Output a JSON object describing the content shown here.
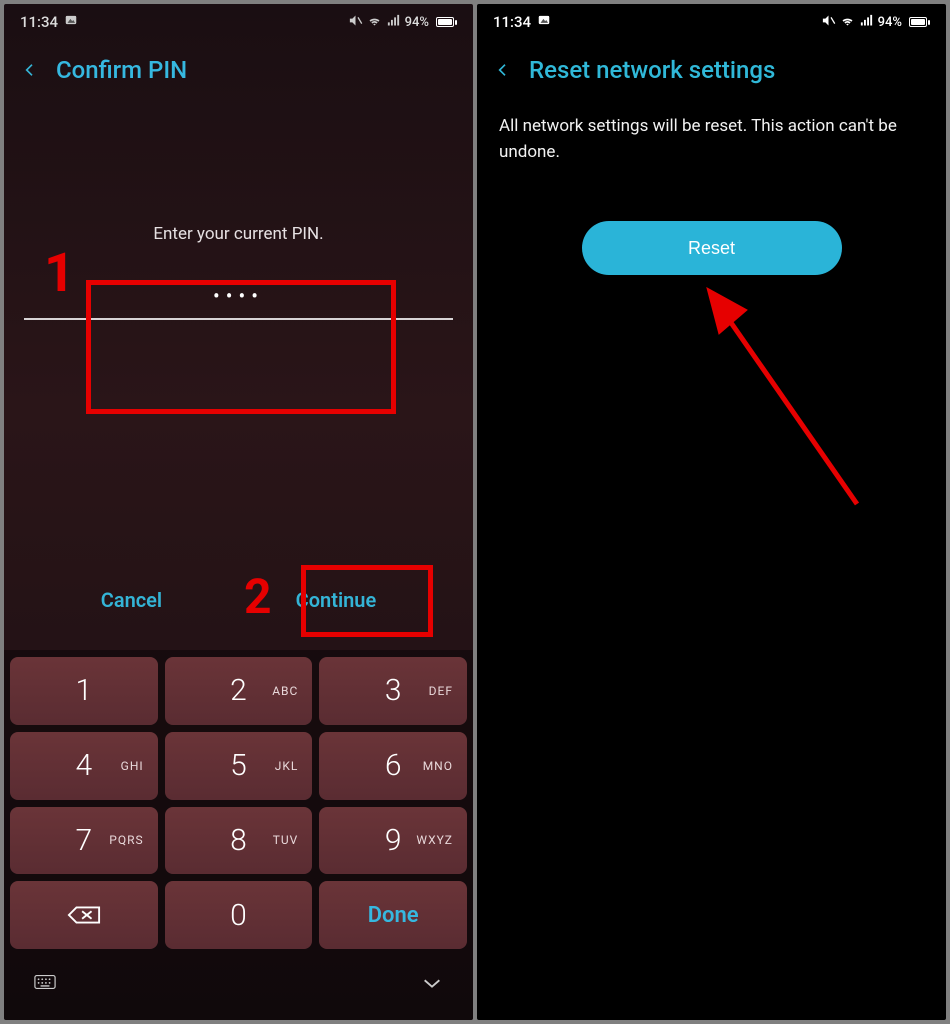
{
  "status": {
    "time": "11:34",
    "battery_pct": "94%"
  },
  "left": {
    "title": "Confirm PIN",
    "prompt": "Enter your current PIN.",
    "pin_display": "••••",
    "cancel": "Cancel",
    "continue": "Continue",
    "keys": [
      {
        "d": "1",
        "s": ""
      },
      {
        "d": "2",
        "s": "ABC"
      },
      {
        "d": "3",
        "s": "DEF"
      },
      {
        "d": "4",
        "s": "GHI"
      },
      {
        "d": "5",
        "s": "JKL"
      },
      {
        "d": "6",
        "s": "MNO"
      },
      {
        "d": "7",
        "s": "PQRS"
      },
      {
        "d": "8",
        "s": "TUV"
      },
      {
        "d": "9",
        "s": "WXYZ"
      }
    ],
    "zero": "0",
    "done": "Done",
    "annot1": "1",
    "annot2": "2"
  },
  "right": {
    "title": "Reset network settings",
    "body": "All network settings will be reset. This action can't be undone.",
    "reset": "Reset"
  }
}
